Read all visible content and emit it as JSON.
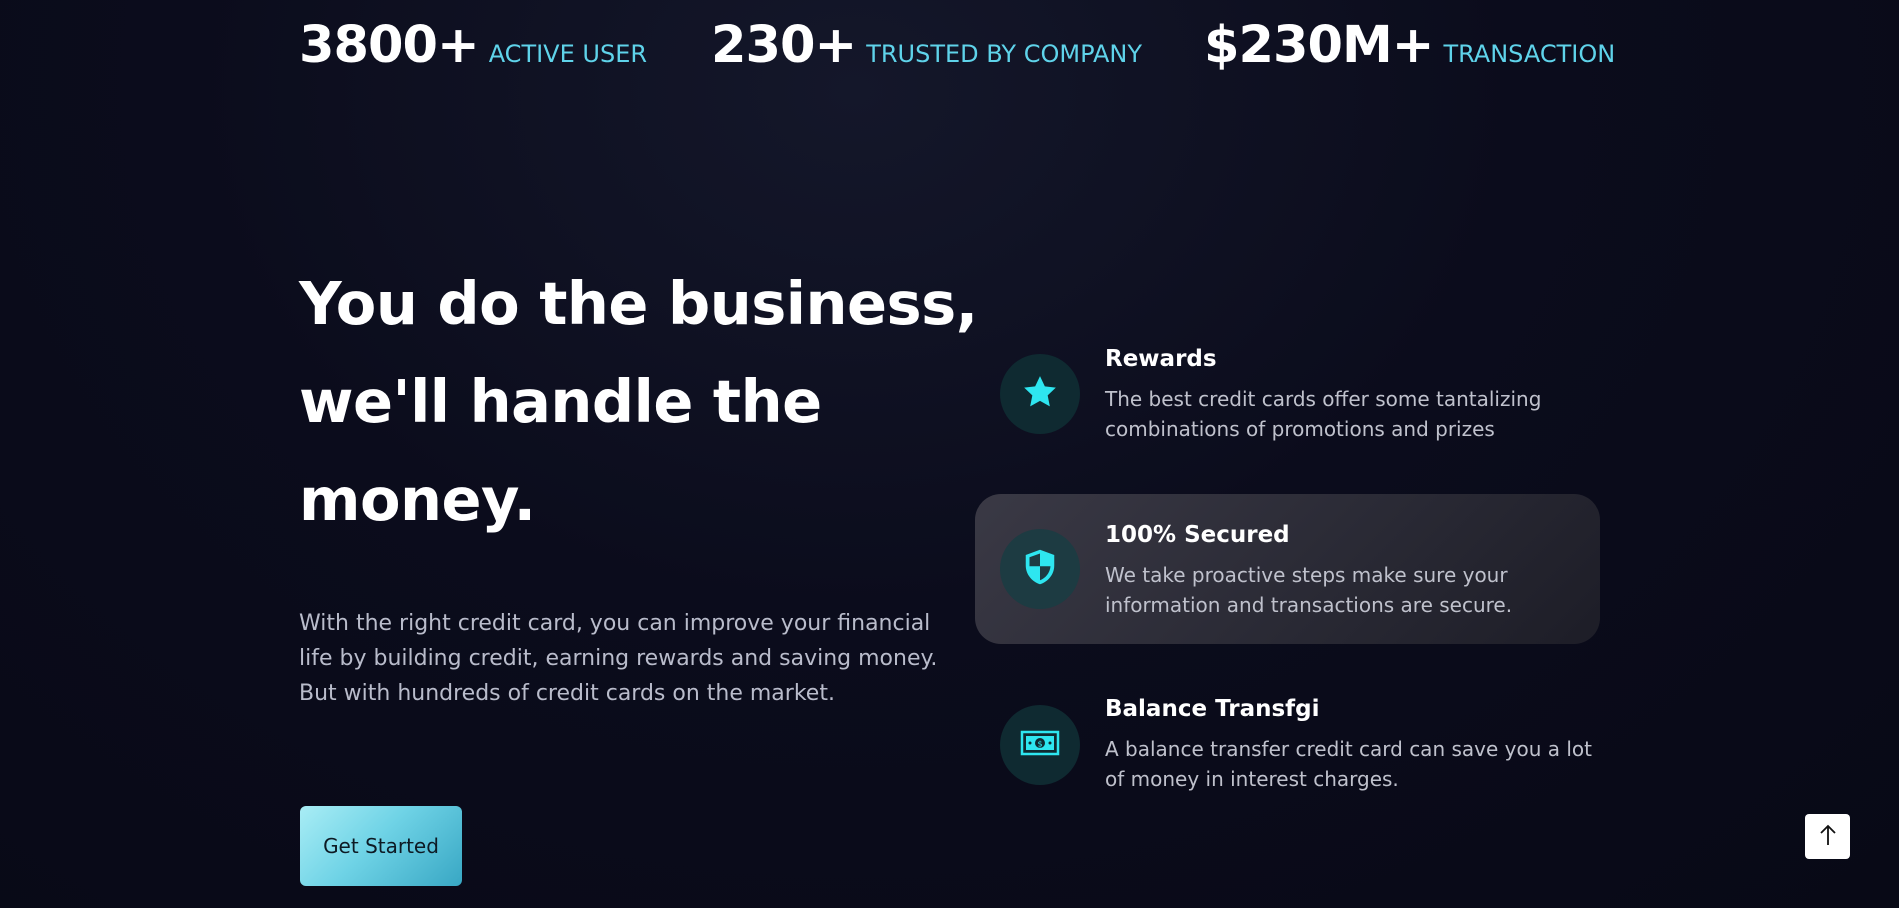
{
  "stats": [
    {
      "value": "3800+",
      "label": "ACTIVE USER"
    },
    {
      "value": "230+",
      "label": "TRUSTED BY COMPANY"
    },
    {
      "value": "$230M+",
      "label": "TRANSACTION"
    }
  ],
  "hero": {
    "headline": "You do the business, we'll handle the money.",
    "description": "With the right credit card, you can improve your financial life by building credit, earning rewards and saving money. But with hundreds of credit cards on the market.",
    "cta_label": "Get Started"
  },
  "features": [
    {
      "icon": "star-icon",
      "title": "Rewards",
      "description": "The best credit cards offer some tantalizing combinations of promotions and prizes"
    },
    {
      "icon": "shield-icon",
      "title": "100% Secured",
      "description": "We take proactive steps make sure your information and transactions are secure."
    },
    {
      "icon": "banknote-icon",
      "title": "Balance Transfgi",
      "description": "A balance transfer credit card can save you a lot of money in interest charges."
    }
  ],
  "scroll_top": {
    "icon": "arrow-up-icon"
  },
  "colors": {
    "accent": "#5fd3ea",
    "icon": "#2ee6f0",
    "background": "#0b0c1c"
  }
}
